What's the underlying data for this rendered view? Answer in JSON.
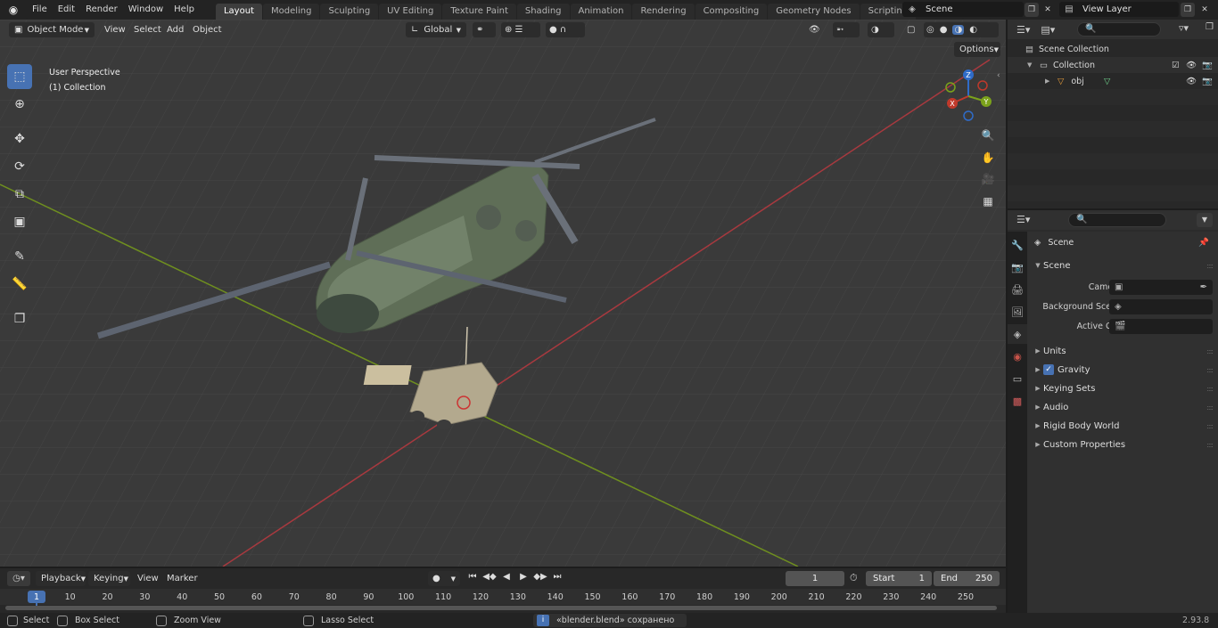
{
  "app": {
    "menu": [
      "File",
      "Edit",
      "Render",
      "Window",
      "Help"
    ],
    "workspaces": [
      "Layout",
      "Modeling",
      "Sculpting",
      "UV Editing",
      "Texture Paint",
      "Shading",
      "Animation",
      "Rendering",
      "Compositing",
      "Geometry Nodes",
      "Scripting"
    ],
    "active_workspace": "Layout",
    "add_workspace": "+",
    "scene_name": "Scene",
    "view_layer": "View Layer"
  },
  "viewport": {
    "mode": "Object Mode",
    "menus": [
      "View",
      "Select",
      "Add",
      "Object"
    ],
    "orientation": "Global",
    "options_label": "Options",
    "info_line1": "User Perspective",
    "info_line2": "(1) Collection",
    "gizmo": {
      "x": "X",
      "y": "Y",
      "z": "Z"
    }
  },
  "outliner": {
    "rows": [
      {
        "label": "Scene Collection"
      },
      {
        "label": "Collection"
      },
      {
        "label": "obj"
      }
    ]
  },
  "properties": {
    "context": "Scene",
    "panel_title": "Scene",
    "fields": [
      {
        "label": "Camera"
      },
      {
        "label": "Background Scene"
      },
      {
        "label": "Active Clip"
      }
    ],
    "subpanels": [
      "Units",
      "Gravity",
      "Keying Sets",
      "Audio",
      "Rigid Body World",
      "Custom Properties"
    ]
  },
  "timeline": {
    "menus": [
      "Playback",
      "Keying",
      "View",
      "Marker"
    ],
    "current_frame": "1",
    "start_label": "Start",
    "start_value": "1",
    "end_label": "End",
    "end_value": "250",
    "ticks": [
      "1",
      "10",
      "20",
      "30",
      "40",
      "50",
      "60",
      "70",
      "80",
      "90",
      "100",
      "110",
      "120",
      "130",
      "140",
      "150",
      "160",
      "170",
      "180",
      "190",
      "200",
      "210",
      "220",
      "230",
      "240",
      "250"
    ]
  },
  "statusbar": {
    "select": "Select",
    "box_select": "Box Select",
    "zoom_view": "Zoom View",
    "lasso_select": "Lasso Select",
    "message": "«blender.blend» сохранено",
    "version": "2.93.8"
  },
  "colors": {
    "accent": "#4772b3",
    "x_axis": "#c0392b",
    "y_axis": "#7ba21b",
    "z_axis": "#2f6cc9"
  }
}
